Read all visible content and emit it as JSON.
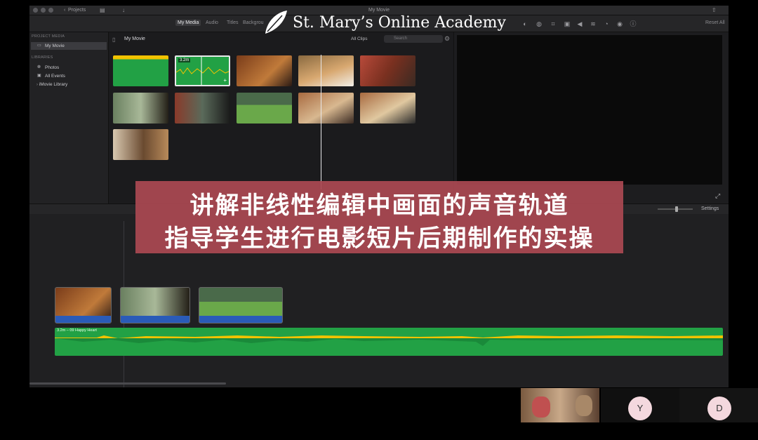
{
  "window": {
    "title": "My Movie",
    "back_label": "Projects",
    "reset_label": "Reset All"
  },
  "toolbar": {
    "tabs": [
      "My Media",
      "Audio",
      "Titles",
      "Backgrou"
    ],
    "active_tab": "My Media"
  },
  "sidebar": {
    "project_media_heading": "PROJECT MEDIA",
    "project_item": "My Movie",
    "libraries_heading": "LIBRARIES",
    "library_items": [
      "Photos",
      "All Events",
      "iMovie Library"
    ]
  },
  "browser": {
    "title": "My Movie",
    "filter": "All Clips",
    "search_placeholder": "Search",
    "selected_clip_duration": "3.2m"
  },
  "timeline": {
    "settings_label": "Settings",
    "music_clip_label": "3.2m – 09 Happy Heart"
  },
  "overlay": {
    "line1": "讲解非线性编辑中画面的声音轨道",
    "line2": "指导学生进行电影短片后期制作的实操"
  },
  "watermark": {
    "text": "St. Mary’s Online Academy"
  },
  "participants": [
    {
      "initial": "Y"
    },
    {
      "initial": "D"
    }
  ],
  "colors": {
    "overlay_bg": "#aa4852",
    "audio_green": "#22a145",
    "audio_yellow": "#f2c300",
    "clip_audio_blue": "#2a5bb8"
  }
}
